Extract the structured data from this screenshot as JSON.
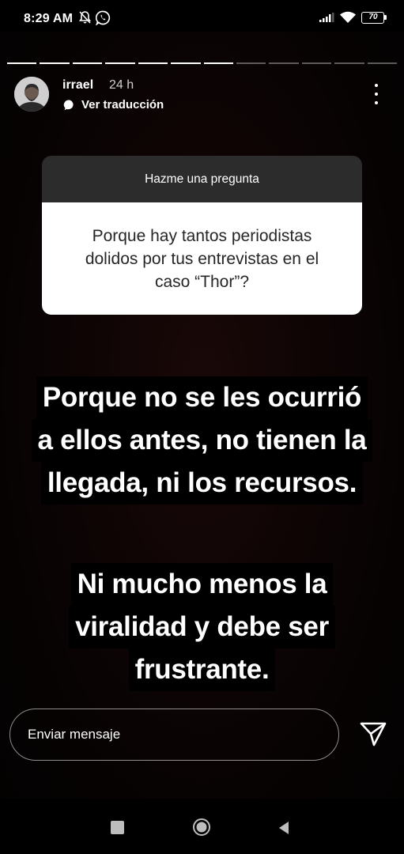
{
  "status_bar": {
    "time": "8:29 AM",
    "battery": "70",
    "icons": [
      "alarm-off-icon",
      "whatsapp-icon",
      "signal-icon",
      "wifi-icon",
      "battery-icon"
    ]
  },
  "story": {
    "progress": {
      "segments": 12,
      "completed": 7
    },
    "user": {
      "username": "irrael",
      "time_ago": "24 h"
    },
    "translate_label": "Ver traducción",
    "question_card": {
      "header": "Hazme una pregunta",
      "question": "Porque hay tantos periodistas dolidos por tus entrevistas en el caso “Thor”?"
    },
    "answer_block_1": [
      "Porque no se les ocurrió",
      "a ellos antes, no tienen la",
      "llegada, ni los recursos."
    ],
    "answer_block_2": [
      "Ni mucho menos la",
      "viralidad y debe ser",
      "frustrante."
    ],
    "colors": {
      "background": "#0d0404",
      "card_header": "#2c2c2c",
      "card_body": "#ffffff",
      "text_bg": "#000000"
    }
  },
  "message_bar": {
    "placeholder": "Enviar mensaje",
    "send_icon": "send-icon"
  },
  "nav_bar": {
    "icons": [
      "recents-icon",
      "home-icon",
      "back-icon"
    ]
  }
}
